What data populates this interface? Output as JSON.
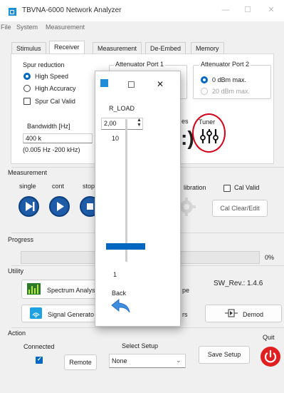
{
  "window": {
    "title": "TBVNA-6000 Network Analyzer",
    "minimize_glyph": "—",
    "maximize_glyph": "☐",
    "close_glyph": "✕"
  },
  "menu": [
    "File",
    "System",
    "Measurement"
  ],
  "tabs": [
    "Stimulus",
    "Receiver",
    "Measurement",
    "De-Embed",
    "Memory"
  ],
  "active_tab": "Receiver",
  "receiver": {
    "spur_reduction": {
      "label": "Spur reduction",
      "options": [
        "High Speed",
        "High Accuracy"
      ],
      "selected": "High Speed",
      "spur_cal_valid": "Spur Cal Valid"
    },
    "attenuator_port1": {
      "label": "Attenuator Port 1"
    },
    "attenuator_port2": {
      "label": "Attenuator Port 2",
      "options": [
        "0 dBm max.",
        "20 dBm max."
      ],
      "selected": "0 dBm max."
    },
    "bandwidth": {
      "label": "Bandwidth [Hz]",
      "value": "400 k",
      "range": "(0.005 Hz -200 kHz)"
    },
    "partial_label": "es",
    "tuner": {
      "label": "Tuner",
      "icon": "tuner-sliders-icon",
      "highlight_color": "#d0021b"
    }
  },
  "measurement": {
    "label": "Measurement",
    "buttons": [
      "single",
      "cont",
      "stop"
    ],
    "calibration_label": "libration",
    "cal_valid": "Cal Valid",
    "cal_clear": "Cal Clear/Edit"
  },
  "progress": {
    "label": "Progress",
    "value": 0,
    "percent_text": "0%"
  },
  "utility": {
    "label": "Utility",
    "spectrum": "Spectrum Analys",
    "signal_gen": "Signal Generato",
    "scope_partial": "pe",
    "filters_partial": "rs",
    "sw_rev": "SW_Rev.: 1.4.6",
    "demod": "Demod"
  },
  "action": {
    "label": "Action",
    "connected": "Connected",
    "remote": "Remote",
    "select_setup": "Select Setup",
    "setup_value": "None",
    "save_setup": "Save Setup",
    "quit": "Quit"
  },
  "dialog": {
    "title": "R_LOAD",
    "spin_value": "2,00",
    "slider_max": "10",
    "slider_min": "1",
    "slider_position": 0.22,
    "back": "Back",
    "maximize_glyph": "☐",
    "close_glyph": "✕"
  },
  "colors": {
    "accent": "#0067c0",
    "circle_buttons": "#1e5ca8",
    "quit_red": "#e02020",
    "dialog_slider": "#0067c0"
  }
}
